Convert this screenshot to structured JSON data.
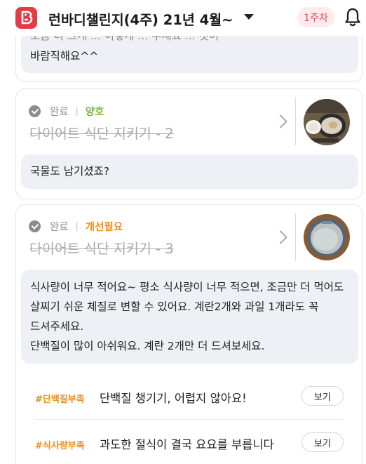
{
  "header": {
    "title": "런바디챌린지(4주) 21년 4월~",
    "week_badge": "1주차"
  },
  "top_comment": {
    "line1": "조금 더 크게 ... 이렇게 ... 주세요 ... 것이",
    "line2": "바람직해요^^"
  },
  "meals": [
    {
      "status": "완료",
      "grade": "양호",
      "grade_color": "#7cb342",
      "title": "다이어트 식단 지키기 - 2",
      "comment_lines": [
        "국물도 남기셨죠?"
      ]
    },
    {
      "status": "완료",
      "grade": "개선필요",
      "grade_color": "#f08c1a",
      "title": "다이어트 식단 지키기 - 3",
      "comment_lines": [
        "식사량이 너무 적어요~ 평소 식사량이 너무 적으면, 조금만 더 먹어도",
        "살찌기 쉬운 체질로 변할 수 있어요. 계란2개와 과일 1개라도 꼭",
        "드셔주세요.",
        "단백질이 많이 아쉬워요. 계란 2개만 더 드셔보세요."
      ]
    }
  ],
  "tips": [
    {
      "tag": "#단백질부족",
      "title": "단백질 챙기기, 어렵지 않아요!",
      "button": "보기"
    },
    {
      "tag": "#식사량부족",
      "title": "과도한 절식이 결국 요요를 부릅니다",
      "button": "보기"
    }
  ],
  "colors": {
    "accent": "#e63946",
    "good": "#7cb342",
    "needs_improvement": "#f08c1a"
  }
}
